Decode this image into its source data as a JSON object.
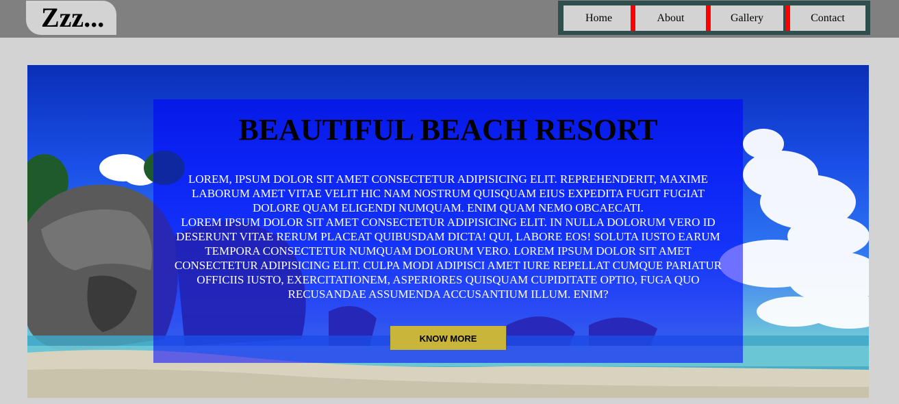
{
  "header": {
    "logo_text": "Zzz...",
    "nav": {
      "items": [
        {
          "label": "Home"
        },
        {
          "label": "About"
        },
        {
          "label": "Gallery"
        },
        {
          "label": "Contact"
        }
      ]
    }
  },
  "hero": {
    "title": "BEAUTIFUL BEACH RESORT",
    "paragraphs": [
      "Lorem, ipsum dolor sit amet consectetur adipisicing elit. Reprehenderit, maxime laborum amet vitae velit hic nam nostrum quisquam eius expedita fugit fugiat dolore quam eligendi numquam. Enim quam nemo obcaecati.",
      "Lorem ipsum dolor sit amet consectetur adipisicing elit. In nulla dolorum vero id deserunt vitae rerum placeat quibusdam dicta! Qui, labore eos! Soluta iusto earum tempora consectetur numquam dolorum vero. Lorem ipsum dolor sit amet consectetur adipisicing elit. Culpa modi adipisci amet iure repellat cumque pariatur officiis iusto, exercitationem, asperiores quisquam cupiditate optio, fuga quo recusandae assumenda accusantium illum. Enim?"
    ],
    "button_label": "KNOW MORE",
    "background_image": "beach-resort-photo"
  },
  "colors": {
    "header_bg": "#808080",
    "page_bg": "#d3d3d3",
    "nav_border": "#2f4f4f",
    "nav_separator": "#ff0000",
    "overlay": "rgba(0,0,255,0.55)",
    "button_bg": "#c9b53a"
  }
}
